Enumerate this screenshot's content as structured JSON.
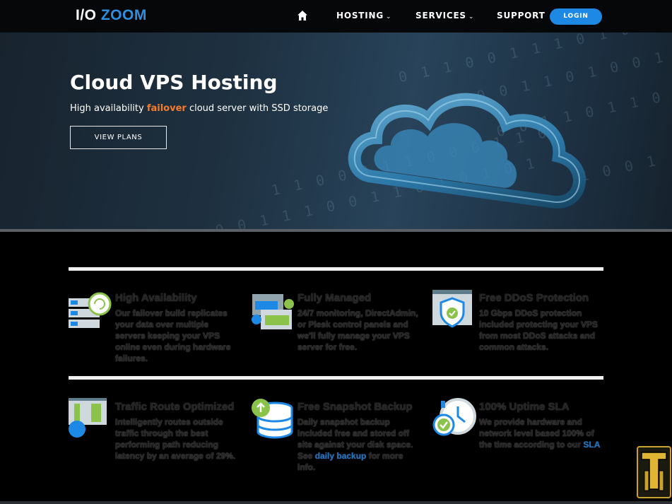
{
  "nav": {
    "logo_io": "I/O",
    "logo_zoom": "ZOOM",
    "home_icon": "home-icon",
    "hosting": "HOSTING",
    "services": "SERVICES",
    "support": "SUPPORT",
    "login": "LOGIN"
  },
  "hero": {
    "title": "Cloud VPS Hosting",
    "sub_pre": "High availability ",
    "sub_highlight": "failover",
    "sub_post": " cloud server with SSD storage",
    "button": "VIEW PLANS"
  },
  "features": [
    {
      "icon": "server-cycle-icon",
      "title": "High Availability",
      "text": "Our failover build replicates your data over multiple servers keeping your VPS online even during hardware failures."
    },
    {
      "icon": "managed-windows-icon",
      "title": "Fully Managed",
      "text": "24/7 monitoring, DirectAdmin, or Plesk control panels and we'll fully manage your VPS server for free."
    },
    {
      "icon": "shield-check-icon",
      "title": "Free DDoS Protection",
      "text": "10 Gbps DDoS protection included protecting your VPS from most DDoS attacks and common attacks."
    },
    {
      "icon": "network-route-icon",
      "title": "Traffic Route Optimized",
      "text": "Intelligently routes outside traffic through the best performing path reducing latency by an average of 29%."
    },
    {
      "icon": "database-snapshot-icon",
      "title": "Free Snapshot Backup",
      "text_pre": "Daily snapshot backup included free and stored off site against your disk space. See ",
      "text_link": "daily backup",
      "text_post": " for more info."
    },
    {
      "icon": "clock-check-icon",
      "title": "100% Uptime SLA",
      "text_pre": "We provide hardware and network level based 100% of the time according to our ",
      "text_link": "SLA",
      "text_post": ""
    }
  ],
  "colors": {
    "accent": "#1e88e5",
    "logo_blue": "#2e8fe0",
    "highlight": "#f47c2a"
  }
}
